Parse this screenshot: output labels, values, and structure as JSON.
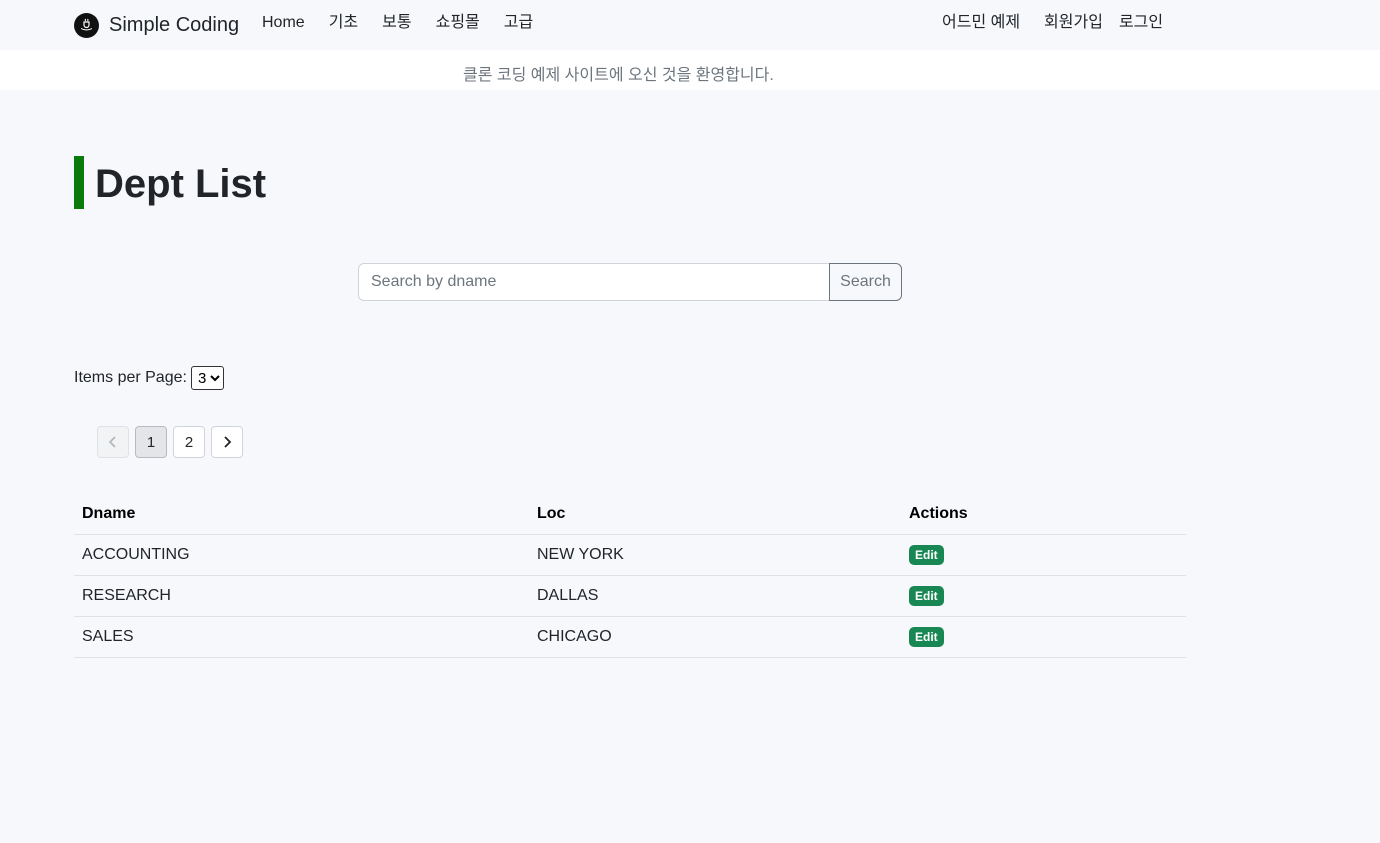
{
  "navbar": {
    "brand": "Simple Coding",
    "links": [
      "Home",
      "기초",
      "보통",
      "쇼핑몰",
      "고급"
    ],
    "right_links": [
      "어드민 예제",
      "회원가입",
      "로그인"
    ]
  },
  "banner": {
    "text": "클론 코딩 예제 사이트에 오신 것을 환영합니다."
  },
  "page": {
    "title": "Dept List"
  },
  "search": {
    "placeholder": "Search by dname",
    "button_label": "Search"
  },
  "items_per_page": {
    "label": "Items per Page:",
    "selected": "3"
  },
  "pagination": {
    "pages": [
      "1",
      "2"
    ],
    "current": "1"
  },
  "table": {
    "headers": [
      "Dname",
      "Loc",
      "Actions"
    ],
    "rows": [
      {
        "dname": "ACCOUNTING",
        "loc": "NEW YORK",
        "action": "Edit"
      },
      {
        "dname": "RESEARCH",
        "loc": "DALLAS",
        "action": "Edit"
      },
      {
        "dname": "SALES",
        "loc": "CHICAGO",
        "action": "Edit"
      }
    ]
  },
  "colors": {
    "accent": "#0a7a0a",
    "edit_badge": "#198754"
  },
  "icons": {
    "brand": "coffee-hand-icon",
    "prev": "chevron-left-icon",
    "next": "chevron-right-icon"
  }
}
